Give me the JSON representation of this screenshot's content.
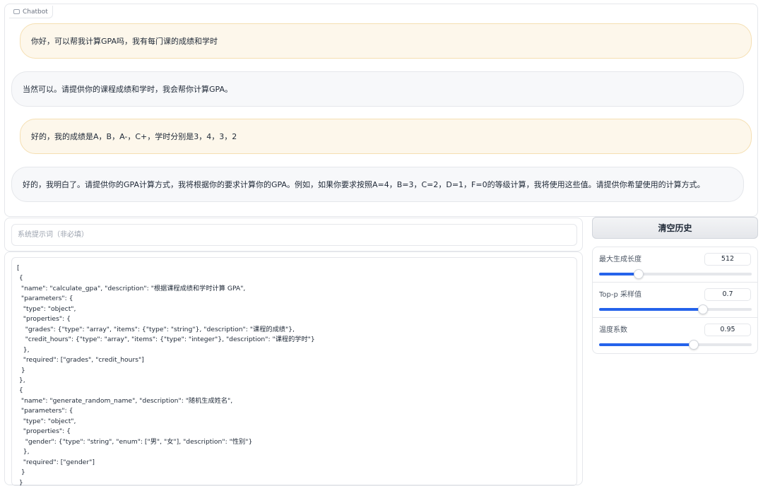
{
  "chatbot": {
    "label": "Chatbot",
    "messages": [
      {
        "role": "user",
        "text": "你好，可以帮我计算GPA吗，我有每门课的成绩和学时"
      },
      {
        "role": "assistant",
        "text": "当然可以。请提供你的课程成绩和学时，我会帮你计算GPA。"
      },
      {
        "role": "user",
        "text": "好的，我的成绩是A，B，A-，C+，学时分别是3，4，3，2"
      },
      {
        "role": "assistant",
        "text": "好的，我明白了。请提供你的GPA计算方式，我将根据你的要求计算你的GPA。例如，如果你要求按照A=4，B=3，C=2，D=1，F=0的等级计算，我将使用这些值。请提供你希望使用的计算方式。"
      }
    ]
  },
  "system_prompt": {
    "placeholder": "系统提示词（非必填）",
    "value": ""
  },
  "tools_text": "[\n {\n  \"name\": \"calculate_gpa\", \"description\": \"根据课程成绩和学时计算 GPA\",\n  \"parameters\": {\n   \"type\": \"object\",\n   \"properties\": {\n    \"grades\": {\"type\": \"array\", \"items\": {\"type\": \"string\"}, \"description\": \"课程的成绩\"},\n    \"credit_hours\": {\"type\": \"array\", \"items\": {\"type\": \"integer\"}, \"description\": \"课程的学时\"}\n   },\n   \"required\": [\"grades\", \"credit_hours\"]\n  }\n },\n {\n  \"name\": \"generate_random_name\", \"description\": \"随机生成姓名\",\n  \"parameters\": {\n   \"type\": \"object\",\n   \"properties\": {\n    \"gender\": {\"type\": \"string\", \"enum\": [\"男\", \"女\"], \"description\": \"性别\"}\n   },\n   \"required\": [\"gender\"]\n  }\n }",
  "controls": {
    "clear_label": "清空历史",
    "max_length": {
      "label": "最大生成长度",
      "value": "512",
      "fraction": 0.26
    },
    "top_p": {
      "label": "Top-p 采样值",
      "value": "0.7",
      "fraction": 0.68
    },
    "temperature": {
      "label": "温度系数",
      "value": "0.95",
      "fraction": 0.62
    }
  },
  "colors": {
    "accent": "#2563eb",
    "user_bubble": "#fdf7eb",
    "bot_bubble": "#f7f8fa"
  }
}
